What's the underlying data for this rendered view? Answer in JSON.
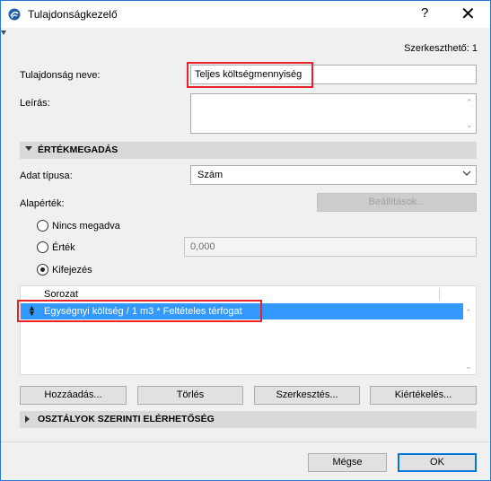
{
  "window": {
    "title": "Tulajdonságkezelő",
    "help_glyph": "?",
    "close_glyph": "✕"
  },
  "header": {
    "editable_count": "Szerkeszthető: 1"
  },
  "property": {
    "name_label": "Tulajdonság neve:",
    "name_value": "Teljes költségmennyiség",
    "description_label": "Leírás:",
    "description_value": ""
  },
  "value_section": {
    "title": "ÉRTÉKMEGADÁS",
    "data_type_label": "Adat típusa:",
    "data_type_value": "Szám",
    "default_label": "Alapérték:",
    "settings_button": "Beállítások...",
    "options": [
      {
        "label": "Nincs megadva",
        "checked": false
      },
      {
        "label": "Érték",
        "checked": false
      },
      {
        "label": "Kifejezés",
        "checked": true
      }
    ],
    "value_field": "0,000",
    "list_header": "Sorozat",
    "list_rows": [
      {
        "text": "Egységnyi költség / 1 m3 * Feltételes térfogat",
        "selected": true
      }
    ]
  },
  "list_buttons": {
    "add": "Hozzáadás...",
    "delete": "Törlés",
    "edit": "Szerkesztés...",
    "evaluate": "Kiértékelés..."
  },
  "classes_section": {
    "title": "OSZTÁLYOK SZERINTI ELÉRHETŐSÉG"
  },
  "footer": {
    "cancel": "Mégse",
    "ok": "OK"
  },
  "colors": {
    "selection": "#3399ff",
    "highlight_box": "#e8242a",
    "window_border": "#2b79d6"
  }
}
